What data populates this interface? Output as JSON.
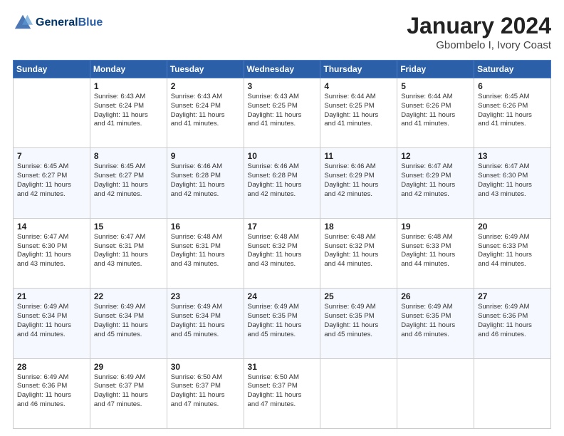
{
  "header": {
    "logo_line1": "General",
    "logo_line2": "Blue",
    "main_title": "January 2024",
    "subtitle": "Gbombelo I, Ivory Coast"
  },
  "days_of_week": [
    "Sunday",
    "Monday",
    "Tuesday",
    "Wednesday",
    "Thursday",
    "Friday",
    "Saturday"
  ],
  "weeks": [
    [
      {
        "day": "",
        "info": ""
      },
      {
        "day": "1",
        "info": "Sunrise: 6:43 AM\nSunset: 6:24 PM\nDaylight: 11 hours\nand 41 minutes."
      },
      {
        "day": "2",
        "info": "Sunrise: 6:43 AM\nSunset: 6:24 PM\nDaylight: 11 hours\nand 41 minutes."
      },
      {
        "day": "3",
        "info": "Sunrise: 6:43 AM\nSunset: 6:25 PM\nDaylight: 11 hours\nand 41 minutes."
      },
      {
        "day": "4",
        "info": "Sunrise: 6:44 AM\nSunset: 6:25 PM\nDaylight: 11 hours\nand 41 minutes."
      },
      {
        "day": "5",
        "info": "Sunrise: 6:44 AM\nSunset: 6:26 PM\nDaylight: 11 hours\nand 41 minutes."
      },
      {
        "day": "6",
        "info": "Sunrise: 6:45 AM\nSunset: 6:26 PM\nDaylight: 11 hours\nand 41 minutes."
      }
    ],
    [
      {
        "day": "7",
        "info": "Sunrise: 6:45 AM\nSunset: 6:27 PM\nDaylight: 11 hours\nand 42 minutes."
      },
      {
        "day": "8",
        "info": "Sunrise: 6:45 AM\nSunset: 6:27 PM\nDaylight: 11 hours\nand 42 minutes."
      },
      {
        "day": "9",
        "info": "Sunrise: 6:46 AM\nSunset: 6:28 PM\nDaylight: 11 hours\nand 42 minutes."
      },
      {
        "day": "10",
        "info": "Sunrise: 6:46 AM\nSunset: 6:28 PM\nDaylight: 11 hours\nand 42 minutes."
      },
      {
        "day": "11",
        "info": "Sunrise: 6:46 AM\nSunset: 6:29 PM\nDaylight: 11 hours\nand 42 minutes."
      },
      {
        "day": "12",
        "info": "Sunrise: 6:47 AM\nSunset: 6:29 PM\nDaylight: 11 hours\nand 42 minutes."
      },
      {
        "day": "13",
        "info": "Sunrise: 6:47 AM\nSunset: 6:30 PM\nDaylight: 11 hours\nand 43 minutes."
      }
    ],
    [
      {
        "day": "14",
        "info": "Sunrise: 6:47 AM\nSunset: 6:30 PM\nDaylight: 11 hours\nand 43 minutes."
      },
      {
        "day": "15",
        "info": "Sunrise: 6:47 AM\nSunset: 6:31 PM\nDaylight: 11 hours\nand 43 minutes."
      },
      {
        "day": "16",
        "info": "Sunrise: 6:48 AM\nSunset: 6:31 PM\nDaylight: 11 hours\nand 43 minutes."
      },
      {
        "day": "17",
        "info": "Sunrise: 6:48 AM\nSunset: 6:32 PM\nDaylight: 11 hours\nand 43 minutes."
      },
      {
        "day": "18",
        "info": "Sunrise: 6:48 AM\nSunset: 6:32 PM\nDaylight: 11 hours\nand 44 minutes."
      },
      {
        "day": "19",
        "info": "Sunrise: 6:48 AM\nSunset: 6:33 PM\nDaylight: 11 hours\nand 44 minutes."
      },
      {
        "day": "20",
        "info": "Sunrise: 6:49 AM\nSunset: 6:33 PM\nDaylight: 11 hours\nand 44 minutes."
      }
    ],
    [
      {
        "day": "21",
        "info": "Sunrise: 6:49 AM\nSunset: 6:34 PM\nDaylight: 11 hours\nand 44 minutes."
      },
      {
        "day": "22",
        "info": "Sunrise: 6:49 AM\nSunset: 6:34 PM\nDaylight: 11 hours\nand 45 minutes."
      },
      {
        "day": "23",
        "info": "Sunrise: 6:49 AM\nSunset: 6:34 PM\nDaylight: 11 hours\nand 45 minutes."
      },
      {
        "day": "24",
        "info": "Sunrise: 6:49 AM\nSunset: 6:35 PM\nDaylight: 11 hours\nand 45 minutes."
      },
      {
        "day": "25",
        "info": "Sunrise: 6:49 AM\nSunset: 6:35 PM\nDaylight: 11 hours\nand 45 minutes."
      },
      {
        "day": "26",
        "info": "Sunrise: 6:49 AM\nSunset: 6:35 PM\nDaylight: 11 hours\nand 46 minutes."
      },
      {
        "day": "27",
        "info": "Sunrise: 6:49 AM\nSunset: 6:36 PM\nDaylight: 11 hours\nand 46 minutes."
      }
    ],
    [
      {
        "day": "28",
        "info": "Sunrise: 6:49 AM\nSunset: 6:36 PM\nDaylight: 11 hours\nand 46 minutes."
      },
      {
        "day": "29",
        "info": "Sunrise: 6:49 AM\nSunset: 6:37 PM\nDaylight: 11 hours\nand 47 minutes."
      },
      {
        "day": "30",
        "info": "Sunrise: 6:50 AM\nSunset: 6:37 PM\nDaylight: 11 hours\nand 47 minutes."
      },
      {
        "day": "31",
        "info": "Sunrise: 6:50 AM\nSunset: 6:37 PM\nDaylight: 11 hours\nand 47 minutes."
      },
      {
        "day": "",
        "info": ""
      },
      {
        "day": "",
        "info": ""
      },
      {
        "day": "",
        "info": ""
      }
    ]
  ]
}
